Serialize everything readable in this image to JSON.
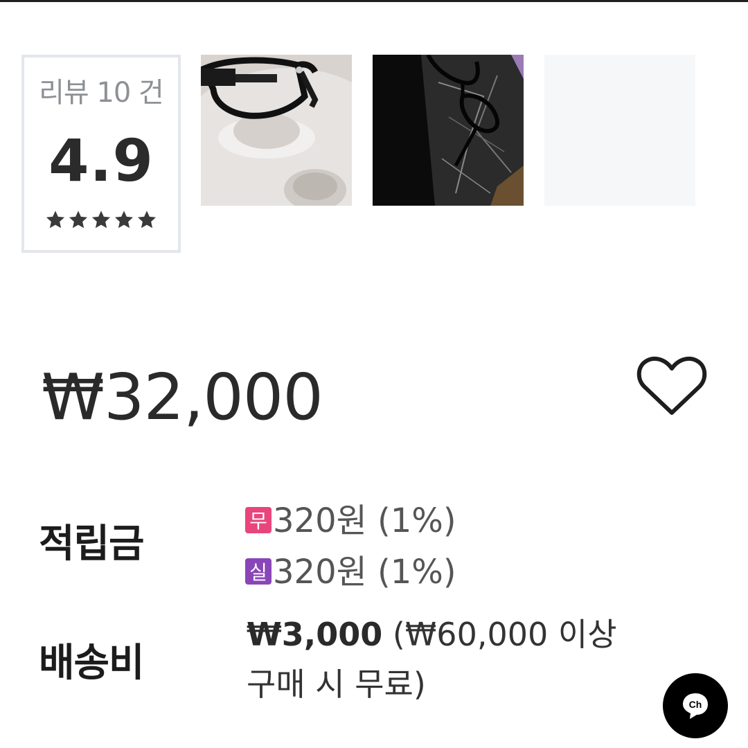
{
  "review": {
    "label": "리뷰 10 건",
    "score": "4.9",
    "rating": 5
  },
  "gallery": {
    "thumbs": [
      {
        "name": "photo-glasses-white-stand"
      },
      {
        "name": "photo-glasses-marble"
      },
      {
        "name": "photo-placeholder"
      }
    ]
  },
  "product": {
    "price": "₩32,000",
    "wishlist_icon": "heart-outline-icon"
  },
  "points": {
    "label": "적립금",
    "lines": [
      {
        "chip": "무",
        "chip_color": "#e8457c",
        "text": "320원 (1%)"
      },
      {
        "chip": "실",
        "chip_color": "#8a46b8",
        "text": "320원 (1%)"
      }
    ]
  },
  "shipping": {
    "label": "배송비",
    "fee": "₩3,000",
    "note": "(₩60,000 이상 구매 시 무료)"
  },
  "chat": {
    "badge": "Ch",
    "icon": "chat-bubble-icon"
  },
  "colors": {
    "border": "#e3e6ea",
    "text": "#222222",
    "chat_bg": "#000000"
  }
}
